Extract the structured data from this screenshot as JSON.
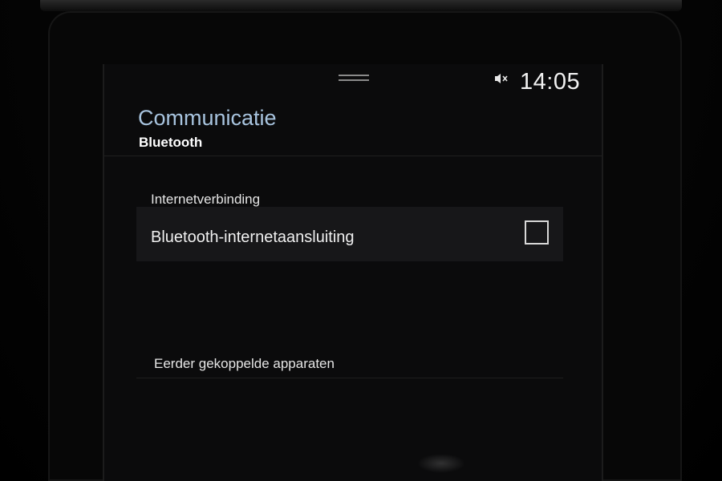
{
  "status_bar": {
    "sound_icon": "speaker-muted-icon",
    "time": "14:05"
  },
  "header": {
    "title": "Communicatie",
    "subtitle": "Bluetooth"
  },
  "sections": {
    "internet": {
      "label": "Internetverbinding",
      "setting": {
        "label": "Bluetooth-internetaansluiting",
        "checked": false
      }
    },
    "paired": {
      "label": "Eerder gekoppelde apparaten"
    }
  },
  "colors": {
    "title_accent": "#a8c4df",
    "background": "#0b0b0c",
    "row_background": "#171719"
  }
}
